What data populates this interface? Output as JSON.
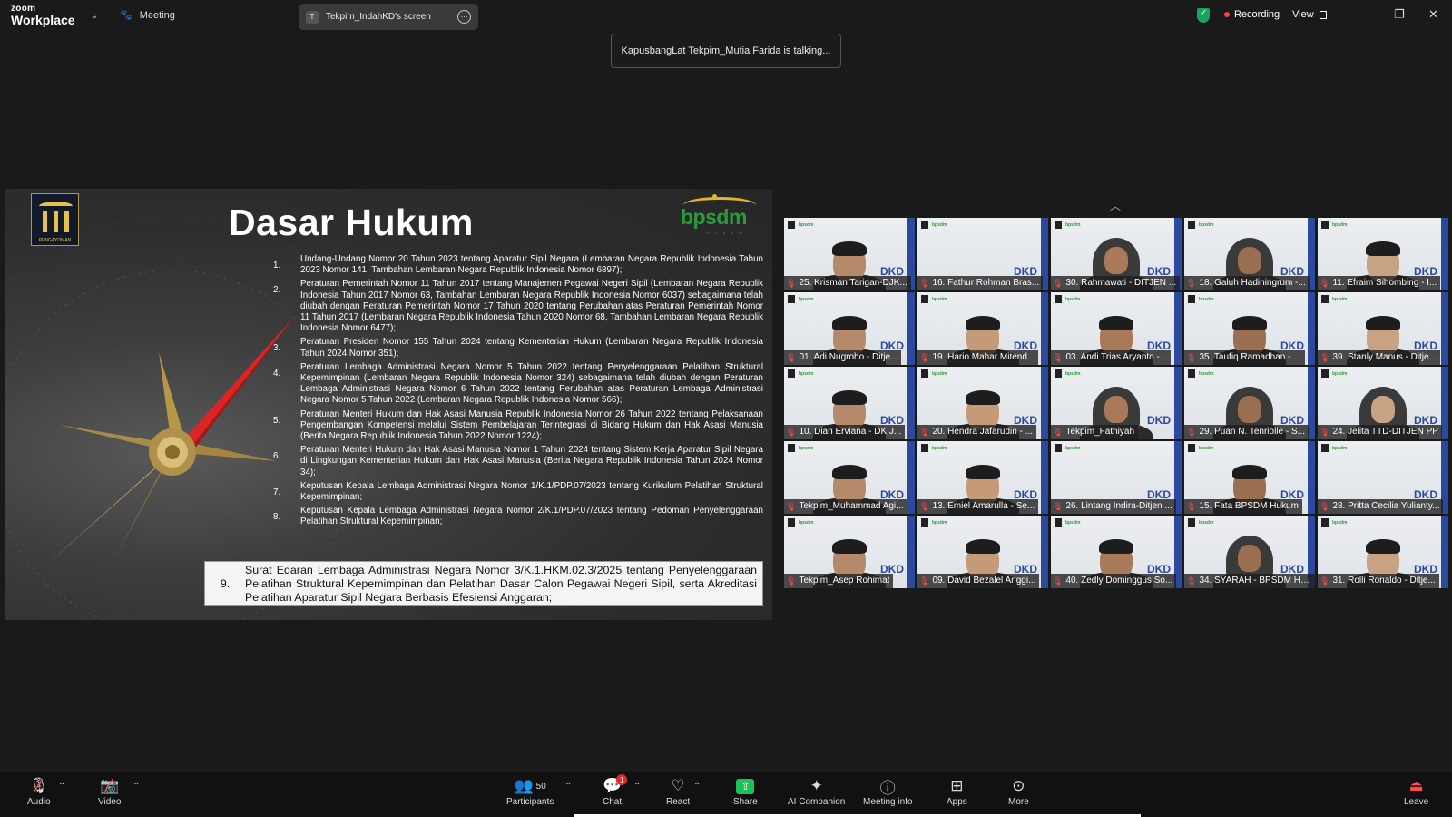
{
  "app": {
    "logo_line1": "zoom",
    "logo_line2": "Workplace",
    "meeting_label": "Meeting",
    "screen_tab_initial": "T",
    "screen_tab_label": "Tekpim_IndahKD's screen",
    "recording_label": "Recording",
    "view_label": "View",
    "talking_notice": "KapusbangLat Tekpim_Mutia Farida is talking..."
  },
  "slide": {
    "title": "Dasar Hukum",
    "logo_left_caption": "PENGAYOMAN",
    "logo_right_text": "bpsdm",
    "logo_right_sub": "HUKUM",
    "laws": [
      {
        "num": "1.",
        "text": "Undang-Undang Nomor 20 Tahun 2023 tentang Aparatur Sipil Negara (Lembaran Negara Republik Indonesia Tahun 2023 Nomor 141, Tambahan Lembaran Negara Republik Indonesia Nomor 6897);"
      },
      {
        "num": "2.",
        "text": "Peraturan Pemerintah Nomor 11 Tahun 2017 tentang Manajemen Pegawai Negeri Sipil (Lembaran Negara Republik Indonesia Tahun 2017 Nomor 63, Tambahan Lembaran Negara Republik Indonesia Nomor 6037) sebagaimana telah diubah dengan Peraturan Pemerintah Nomor 17 Tahun 2020 tentang Perubahan atas Peraturan Pemerintah Nomor 11 Tahun 2017 (Lembaran Negara Republik Indonesia Tahun 2020 Nomor 68, Tambahan Lembaran Negara Republik Indonesia Nomor 6477);"
      },
      {
        "num": "3.",
        "text": "Peraturan Presiden Nomor 155 Tahun 2024 tentang Kementerian Hukum (Lembaran Negara Republik Indonesia Tahun 2024 Nomor 351);"
      },
      {
        "num": "4.",
        "text": "Peraturan Lembaga Administrasi Negara Nomor 5 Tahun 2022 tentang Penyelenggaraan Pelatihan Struktural Kepemimpinan (Lembaran Negara Republik Indonesia Nomor 324) sebagaimana telah diubah dengan Peraturan Lembaga Administrasi Negara Nomor 6 Tahun 2022 tentang Perubahan atas Peraturan Lembaga Administrasi Negara Nomor 5 Tahun 2022 (Lembaran Negara Republik Indonesia Nomor 566);"
      },
      {
        "num": "5.",
        "text": "Peraturan Menteri Hukum dan Hak Asasi Manusia Republik Indonesia Nomor 26 Tahun 2022 tentang Pelaksanaan Pengembangan Kompetensi melalui Sistem Pembelajaran Terintegrasi di Bidang Hukum dan Hak Asasi Manusia (Berita Negara Republik Indonesia Tahun 2022 Nomor 1224);"
      },
      {
        "num": "6.",
        "text": "Peraturan Menteri Hukum dan Hak Asasi Manusia Nomor 1 Tahun 2024 tentang Sistem Kerja Aparatur Sipil Negara di Lingkungan Kementerian Hukum dan Hak Asasi Manusia (Berita Negara Republik Indonesia Tahun 2024 Nomor 34);"
      },
      {
        "num": "7.",
        "text": "Keputusan Kepala Lembaga Administrasi Negara Nomor 1/K.1/PDP.07/2023 tentang Kurikulum Pelatihan Struktural Kepemimpinan;"
      },
      {
        "num": "8.",
        "text": "Keputusan Kepala Lembaga Administrasi Negara Nomor 2/K.1/PDP.07/2023 tentang Pedoman Penyelenggaraan Pelatihan Struktural Kepemimpinan;"
      }
    ],
    "law9": {
      "num": "9.",
      "text": "Surat Edaran Lembaga Administrasi Negara Nomor 3/K.1.HKM.02.3/2025 tentang Penyelenggaraan Pelatihan Struktural Kepemimpinan dan Pelatihan Dasar Calon Pegawai Negeri Sipil, serta Akreditasi Pelatihan Aparatur Sipil Negara Berbasis Efesiensi Anggaran;"
    }
  },
  "participants": [
    {
      "name": "25. Krisman Tarigan-DJK...",
      "style": "man"
    },
    {
      "name": "16. Fathur Rohman Bras...",
      "style": "empty"
    },
    {
      "name": "30. Rahmawati - DITJEN ...",
      "style": "hijab"
    },
    {
      "name": "18. Galuh Hadiningrum -...",
      "style": "hijab"
    },
    {
      "name": "11. Efraim Sihombing - I...",
      "style": "man"
    },
    {
      "name": "01. Adi Nugroho - Ditje...",
      "style": "man"
    },
    {
      "name": "19. Hario Mahar Mitend...",
      "style": "man"
    },
    {
      "name": "03. Andi Trias Aryanto -...",
      "style": "man"
    },
    {
      "name": "35. Taufiq Ramadhan - ...",
      "style": "man"
    },
    {
      "name": "39. Stanly Manus - Ditje...",
      "style": "man"
    },
    {
      "name": "10. Dian Erviana - DK J...",
      "style": "woman"
    },
    {
      "name": "20. Hendra Jafarudin - ...",
      "style": "man"
    },
    {
      "name": "Tekpim_Fathiyah",
      "style": "hijab"
    },
    {
      "name": "29. Puan N. Tenriolle - S...",
      "style": "hijab"
    },
    {
      "name": "24. Jelita TTD-DITJEN PP",
      "style": "hijab"
    },
    {
      "name": "Tekpim_Muhammad Agi...",
      "style": "man"
    },
    {
      "name": "13. Emiel Amarulla - Se...",
      "style": "man"
    },
    {
      "name": "26. Lintang Indira-Ditjen ...",
      "style": "empty"
    },
    {
      "name": "15. Fata BPSDM Hukum",
      "style": "man"
    },
    {
      "name": "28. Pritta Cecilia Yulianty...",
      "style": "empty"
    },
    {
      "name": "Tekpim_Asep Rohimat",
      "style": "man"
    },
    {
      "name": "09. David Bezalel Anggi...",
      "style": "man"
    },
    {
      "name": "40. Zedly Dominggus So...",
      "style": "man"
    },
    {
      "name": "34. SYARAH - BPSDM Hu...",
      "style": "hijab"
    },
    {
      "name": "31. Rolli Ronaldo - Ditje...",
      "style": "man"
    }
  ],
  "tile_brand": "bpsdm",
  "tile_badge": "DKD",
  "toolbar": {
    "audio": "Audio",
    "video": "Video",
    "participants": "Participants",
    "participants_count": "50",
    "chat": "Chat",
    "chat_badge": "1",
    "react": "React",
    "share": "Share",
    "ai_companion": "AI Companion",
    "meeting_info": "Meeting info",
    "apps": "Apps",
    "more": "More",
    "leave": "Leave"
  },
  "colors": {
    "accent_green": "#1fbf5a",
    "record_red": "#ff4040",
    "slide_highlight": "#f4f4f4"
  }
}
